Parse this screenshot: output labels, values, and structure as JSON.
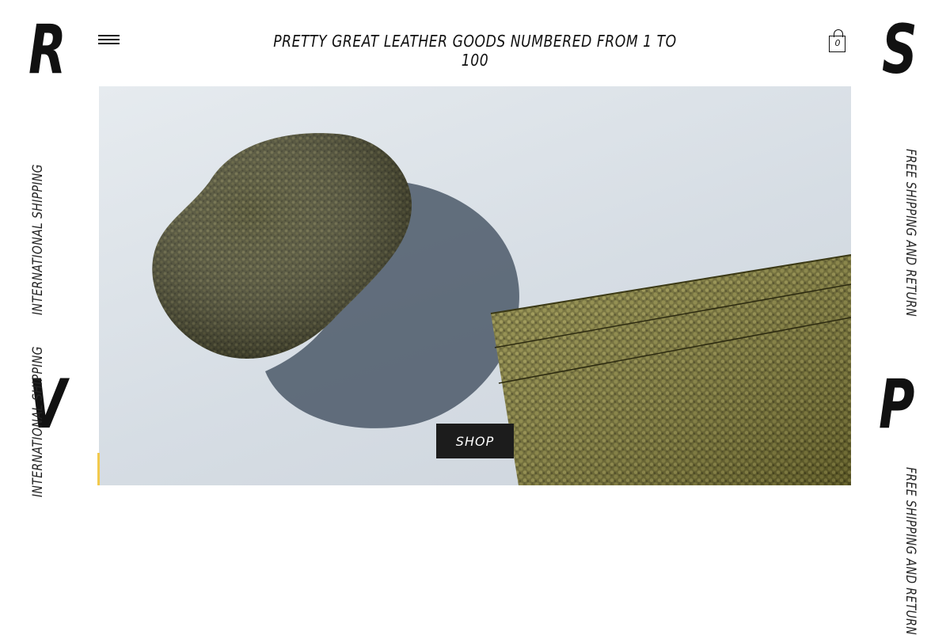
{
  "brand_letters": {
    "top_left": "R",
    "bottom_left": "V",
    "top_right": "S",
    "bottom_right": "P"
  },
  "side_text": {
    "left_1": "INTERNATIONAL SHIPPING",
    "left_2": "INTERNATIONAL SHIPPING",
    "right_1": "FREE SHIPPING AND RETURN",
    "right_2": "FREE SHIPPING AND RETURN"
  },
  "header": {
    "tagline": "PRETTY GREAT LEATHER GOODS NUMBERED FROM 1 TO 100",
    "menu_icon": "hamburger-menu-icon",
    "cart_icon": "shopping-bag-icon",
    "cart_count": "0"
  },
  "hero": {
    "shop_label": "SHOP",
    "image_subject": "avocado-and-leather-cardholder"
  },
  "colors": {
    "background": "#ffffff",
    "text": "#111111",
    "button": "#1c1c1c",
    "accent": "#f2c94c"
  }
}
